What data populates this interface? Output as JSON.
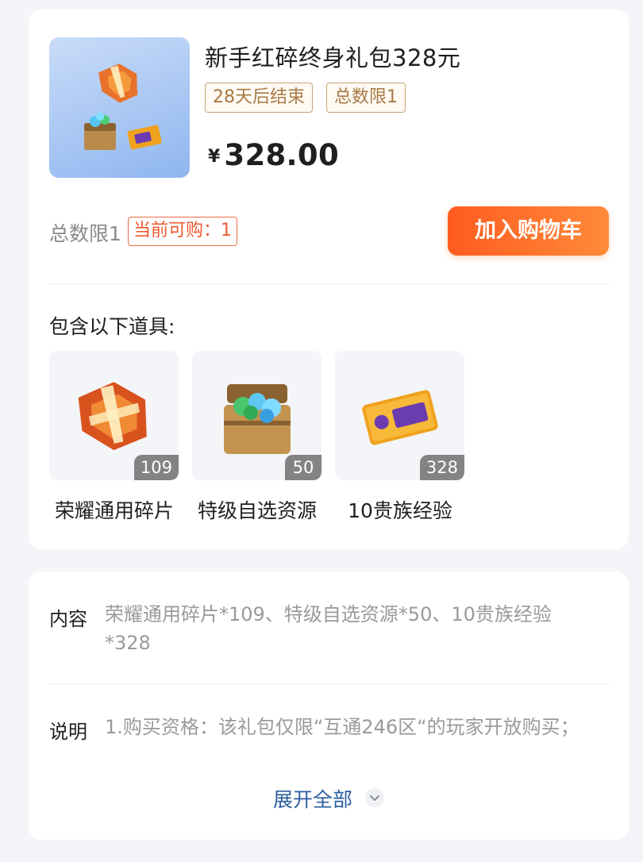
{
  "pack": {
    "title": "新手红碎终身礼包328元",
    "tag_end": "28天后结束",
    "tag_limit": "总数限1",
    "price_symbol": "¥",
    "price": "328.00",
    "total_limit": "总数限1",
    "can_buy": "当前可购：1",
    "cart_button": "加入购物车"
  },
  "includes": {
    "title": "包含以下道具:",
    "items": [
      {
        "name": "荣耀通用碎片",
        "qty": "109"
      },
      {
        "name": "特级自选资源",
        "qty": "50"
      },
      {
        "name": "10贵族经验",
        "qty": "328"
      }
    ]
  },
  "details": {
    "content_label": "内容",
    "content_text": "荣耀通用碎片*109、特级自选资源*50、10贵族经验*328",
    "desc_label": "说明",
    "desc_text": "1.购买资格：该礼包仅限“互通246区“的玩家开放购买；",
    "expand_label": "展开全部"
  },
  "icons": {
    "pack_image": "gift-pack-image",
    "item_1": "honor-fragment-icon",
    "item_2": "resource-chest-icon",
    "item_3": "noble-card-icon",
    "expand": "chevron-down-icon"
  },
  "colors": {
    "accent": "#ff6a2b",
    "tag": "#a87a44",
    "link": "#2b5f9e"
  }
}
